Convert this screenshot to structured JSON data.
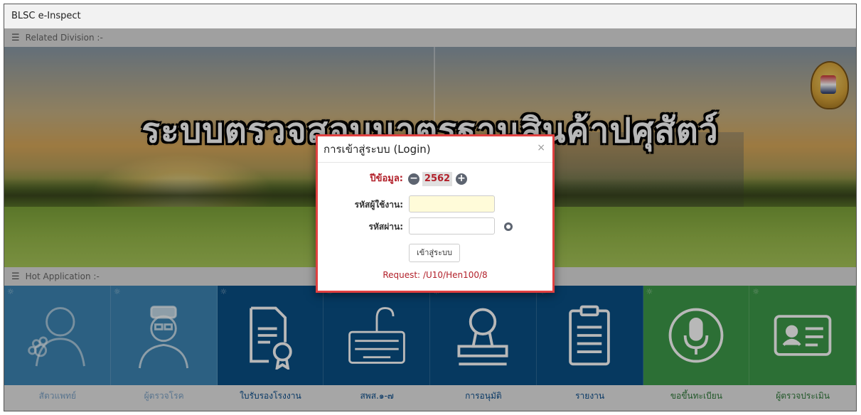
{
  "app": {
    "title": "BLSC e-Inspect"
  },
  "sections": {
    "related": "Related Division :-",
    "hot": "Hot Application :-"
  },
  "banner": {
    "title": "ระบบตรวจสอบมาตรฐานสินค้าปศุสัตว์"
  },
  "login": {
    "title": "การเข้าสู่ระบบ (Login)",
    "close": "×",
    "year_label": "ปีข้อมูล:",
    "year_value": "2562",
    "username_label": "รหัสผู้ใช้งาน:",
    "username_value": "",
    "password_label": "รหัสผ่าน:",
    "password_value": "",
    "submit": "เข้าสู่ระบบ",
    "request_label": "Request:",
    "request_path": "/U10/Hen100/8"
  },
  "apps": [
    {
      "label": "สัตวแพทย์",
      "icon": "veterinarian-icon",
      "color": "#3e86b4"
    },
    {
      "label": "ผู้ตรวจโรค",
      "icon": "doctor-icon",
      "color": "#3e86b4"
    },
    {
      "label": "ใบรับรองโรงงาน",
      "icon": "certificate-icon",
      "color": "#094f85"
    },
    {
      "label": "สพส.๑-๗",
      "icon": "keyboard-icon",
      "color": "#094f85"
    },
    {
      "label": "การอนุมัติ",
      "icon": "stamp-icon",
      "color": "#094f85"
    },
    {
      "label": "รายงาน",
      "icon": "report-clipboard-icon",
      "color": "#094f85"
    },
    {
      "label": "ขอขึ้นทะเบียน",
      "icon": "microphone-icon",
      "color": "#3e9a4a"
    },
    {
      "label": "ผู้ตรวจประเมิน",
      "icon": "id-card-icon",
      "color": "#3e9a4a"
    }
  ]
}
